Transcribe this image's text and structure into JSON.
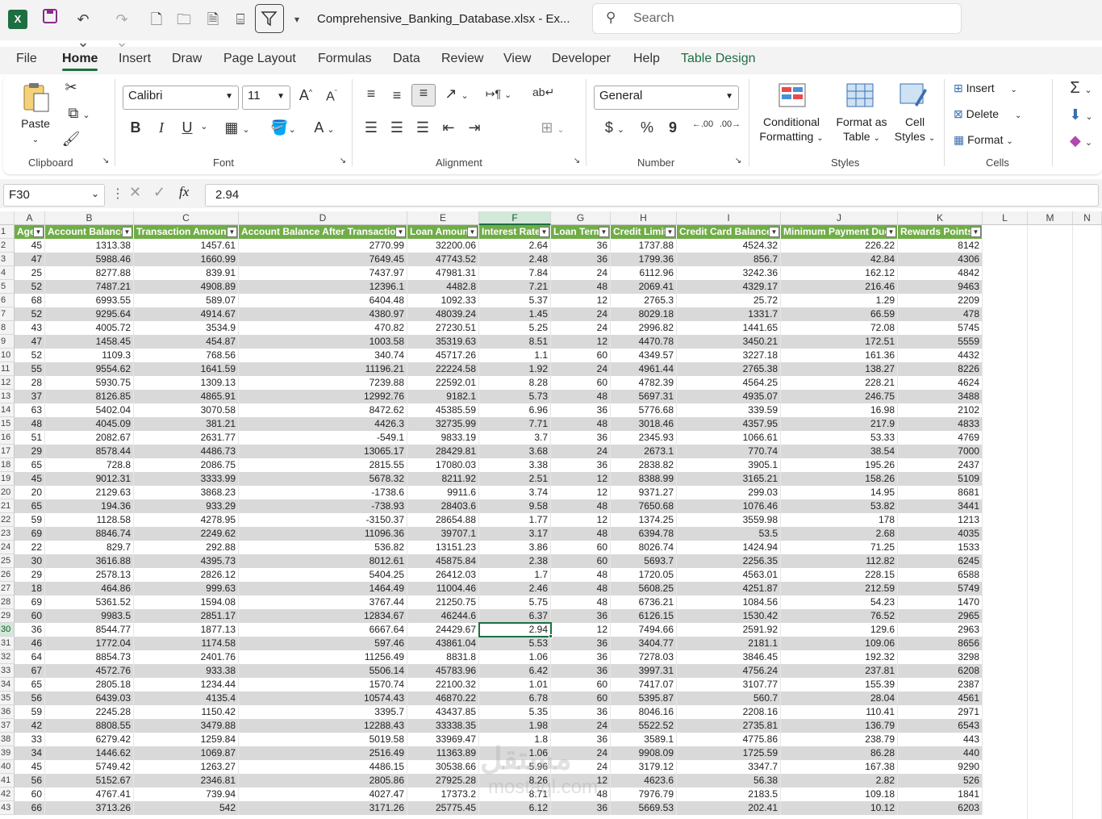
{
  "window": {
    "title": "Comprehensive_Banking_Database.xlsx  -  Ex...",
    "app_logo": "X",
    "search_placeholder": "Search"
  },
  "ribbon_tabs": [
    "File",
    "Home",
    "Insert",
    "Draw",
    "Page Layout",
    "Formulas",
    "Data",
    "Review",
    "View",
    "Developer",
    "Help",
    "Table Design"
  ],
  "active_tab": "Home",
  "ribbon": {
    "clipboard": {
      "paste_label": "Paste",
      "group_label": "Clipboard"
    },
    "font": {
      "font_name": "Calibri",
      "font_size": "11",
      "group_label": "Font",
      "bold": "B",
      "italic": "I",
      "underline": "U",
      "grow": "A",
      "shrink": "A",
      "color": "A"
    },
    "alignment": {
      "group_label": "Alignment"
    },
    "number": {
      "format": "General",
      "group_label": "Number",
      "currency": "$",
      "percent": "%",
      "comma": "9",
      "inc_decimal": ".00",
      "dec_decimal": ".00"
    },
    "styles": {
      "conditional_formatting_1": "Conditional",
      "conditional_formatting_2": "Formatting",
      "format_as_table_1": "Format as",
      "format_as_table_2": "Table",
      "cell_styles_1": "Cell",
      "cell_styles_2": "Styles",
      "group_label": "Styles"
    },
    "cells": {
      "insert_label": "Insert",
      "delete_label": "Delete",
      "format_label": "Format",
      "group_label": "Cells"
    }
  },
  "formula_bar": {
    "name_box": "F30",
    "fx": "fx",
    "formula": "2.94"
  },
  "columns": [
    "A",
    "B",
    "C",
    "D",
    "E",
    "F",
    "G",
    "H",
    "I",
    "J",
    "K",
    "L",
    "M",
    "N"
  ],
  "selected_cell": {
    "row": 30,
    "col": "F"
  },
  "table_headers": [
    "Age",
    "Account Balance",
    "Transaction Amount",
    "Account Balance After Transaction",
    "Loan Amount",
    "Interest Rate",
    "Loan Term",
    "Credit Limit",
    "Credit Card Balance",
    "Minimum Payment Due",
    "Rewards Points"
  ],
  "rows": [
    [
      "45",
      "1313.38",
      "1457.61",
      "2770.99",
      "32200.06",
      "2.64",
      "36",
      "1737.88",
      "4524.32",
      "226.22",
      "8142"
    ],
    [
      "47",
      "5988.46",
      "1660.99",
      "7649.45",
      "47743.52",
      "2.48",
      "36",
      "1799.36",
      "856.7",
      "42.84",
      "4306"
    ],
    [
      "25",
      "8277.88",
      "839.91",
      "7437.97",
      "47981.31",
      "7.84",
      "24",
      "6112.96",
      "3242.36",
      "162.12",
      "4842"
    ],
    [
      "52",
      "7487.21",
      "4908.89",
      "12396.1",
      "4482.8",
      "7.21",
      "48",
      "2069.41",
      "4329.17",
      "216.46",
      "9463"
    ],
    [
      "68",
      "6993.55",
      "589.07",
      "6404.48",
      "1092.33",
      "5.37",
      "12",
      "2765.3",
      "25.72",
      "1.29",
      "2209"
    ],
    [
      "52",
      "9295.64",
      "4914.67",
      "4380.97",
      "48039.24",
      "1.45",
      "24",
      "8029.18",
      "1331.7",
      "66.59",
      "478"
    ],
    [
      "43",
      "4005.72",
      "3534.9",
      "470.82",
      "27230.51",
      "5.25",
      "24",
      "2996.82",
      "1441.65",
      "72.08",
      "5745"
    ],
    [
      "47",
      "1458.45",
      "454.87",
      "1003.58",
      "35319.63",
      "8.51",
      "12",
      "4470.78",
      "3450.21",
      "172.51",
      "5559"
    ],
    [
      "52",
      "1109.3",
      "768.56",
      "340.74",
      "45717.26",
      "1.1",
      "60",
      "4349.57",
      "3227.18",
      "161.36",
      "4432"
    ],
    [
      "55",
      "9554.62",
      "1641.59",
      "11196.21",
      "22224.58",
      "1.92",
      "24",
      "4961.44",
      "2765.38",
      "138.27",
      "8226"
    ],
    [
      "28",
      "5930.75",
      "1309.13",
      "7239.88",
      "22592.01",
      "8.28",
      "60",
      "4782.39",
      "4564.25",
      "228.21",
      "4624"
    ],
    [
      "37",
      "8126.85",
      "4865.91",
      "12992.76",
      "9182.1",
      "5.73",
      "48",
      "5697.31",
      "4935.07",
      "246.75",
      "3488"
    ],
    [
      "63",
      "5402.04",
      "3070.58",
      "8472.62",
      "45385.59",
      "6.96",
      "36",
      "5776.68",
      "339.59",
      "16.98",
      "2102"
    ],
    [
      "48",
      "4045.09",
      "381.21",
      "4426.3",
      "32735.99",
      "7.71",
      "48",
      "3018.46",
      "4357.95",
      "217.9",
      "4833"
    ],
    [
      "51",
      "2082.67",
      "2631.77",
      "-549.1",
      "9833.19",
      "3.7",
      "36",
      "2345.93",
      "1066.61",
      "53.33",
      "4769"
    ],
    [
      "29",
      "8578.44",
      "4486.73",
      "13065.17",
      "28429.81",
      "3.68",
      "24",
      "2673.1",
      "770.74",
      "38.54",
      "7000"
    ],
    [
      "65",
      "728.8",
      "2086.75",
      "2815.55",
      "17080.03",
      "3.38",
      "36",
      "2838.82",
      "3905.1",
      "195.26",
      "2437"
    ],
    [
      "45",
      "9012.31",
      "3333.99",
      "5678.32",
      "8211.92",
      "2.51",
      "12",
      "8388.99",
      "3165.21",
      "158.26",
      "5109"
    ],
    [
      "20",
      "2129.63",
      "3868.23",
      "-1738.6",
      "9911.6",
      "3.74",
      "12",
      "9371.27",
      "299.03",
      "14.95",
      "8681"
    ],
    [
      "65",
      "194.36",
      "933.29",
      "-738.93",
      "28403.6",
      "9.58",
      "48",
      "7650.68",
      "1076.46",
      "53.82",
      "3441"
    ],
    [
      "59",
      "1128.58",
      "4278.95",
      "-3150.37",
      "28654.88",
      "1.77",
      "12",
      "1374.25",
      "3559.98",
      "178",
      "1213"
    ],
    [
      "69",
      "8846.74",
      "2249.62",
      "11096.36",
      "39707.1",
      "3.17",
      "48",
      "6394.78",
      "53.5",
      "2.68",
      "4035"
    ],
    [
      "22",
      "829.7",
      "292.88",
      "536.82",
      "13151.23",
      "3.86",
      "60",
      "8026.74",
      "1424.94",
      "71.25",
      "1533"
    ],
    [
      "30",
      "3616.88",
      "4395.73",
      "8012.61",
      "45875.84",
      "2.38",
      "60",
      "5693.7",
      "2256.35",
      "112.82",
      "6245"
    ],
    [
      "29",
      "2578.13",
      "2826.12",
      "5404.25",
      "26412.03",
      "1.7",
      "48",
      "1720.05",
      "4563.01",
      "228.15",
      "6588"
    ],
    [
      "18",
      "464.86",
      "999.63",
      "1464.49",
      "11004.46",
      "2.46",
      "48",
      "5608.25",
      "4251.87",
      "212.59",
      "5749"
    ],
    [
      "69",
      "5361.52",
      "1594.08",
      "3767.44",
      "21250.75",
      "5.75",
      "48",
      "6736.21",
      "1084.56",
      "54.23",
      "1470"
    ],
    [
      "60",
      "9983.5",
      "2851.17",
      "12834.67",
      "46244.6",
      "6.37",
      "36",
      "6126.15",
      "1530.42",
      "76.52",
      "2965"
    ],
    [
      "36",
      "8544.77",
      "1877.13",
      "6667.64",
      "24429.67",
      "2.94",
      "12",
      "7494.66",
      "2591.92",
      "129.6",
      "2963"
    ],
    [
      "46",
      "1772.04",
      "1174.58",
      "597.46",
      "43861.04",
      "5.53",
      "36",
      "3404.77",
      "2181.1",
      "109.06",
      "8656"
    ],
    [
      "64",
      "8854.73",
      "2401.76",
      "11256.49",
      "8831.8",
      "1.06",
      "36",
      "7278.03",
      "3846.45",
      "192.32",
      "3298"
    ],
    [
      "67",
      "4572.76",
      "933.38",
      "5506.14",
      "45783.96",
      "6.42",
      "36",
      "3997.31",
      "4756.24",
      "237.81",
      "6208"
    ],
    [
      "65",
      "2805.18",
      "1234.44",
      "1570.74",
      "22100.32",
      "1.01",
      "60",
      "7417.07",
      "3107.77",
      "155.39",
      "2387"
    ],
    [
      "56",
      "6439.03",
      "4135.4",
      "10574.43",
      "46870.22",
      "6.78",
      "60",
      "5395.87",
      "560.7",
      "28.04",
      "4561"
    ],
    [
      "59",
      "2245.28",
      "1150.42",
      "3395.7",
      "43437.85",
      "5.35",
      "36",
      "8046.16",
      "2208.16",
      "110.41",
      "2971"
    ],
    [
      "42",
      "8808.55",
      "3479.88",
      "12288.43",
      "33338.35",
      "1.98",
      "24",
      "5522.52",
      "2735.81",
      "136.79",
      "6543"
    ],
    [
      "33",
      "6279.42",
      "1259.84",
      "5019.58",
      "33969.47",
      "1.8",
      "36",
      "3589.1",
      "4775.86",
      "238.79",
      "443"
    ],
    [
      "34",
      "1446.62",
      "1069.87",
      "2516.49",
      "11363.89",
      "1.06",
      "24",
      "9908.09",
      "1725.59",
      "86.28",
      "440"
    ],
    [
      "45",
      "5749.42",
      "1263.27",
      "4486.15",
      "30538.66",
      "5.96",
      "24",
      "3179.12",
      "3347.7",
      "167.38",
      "9290"
    ],
    [
      "56",
      "5152.67",
      "2346.81",
      "2805.86",
      "27925.28",
      "8.26",
      "12",
      "4623.6",
      "56.38",
      "2.82",
      "526"
    ],
    [
      "60",
      "4767.41",
      "739.94",
      "4027.47",
      "17373.2",
      "8.71",
      "48",
      "7976.79",
      "2183.5",
      "109.18",
      "1841"
    ],
    [
      "66",
      "3713.26",
      "542",
      "3171.26",
      "25775.45",
      "6.12",
      "36",
      "5669.53",
      "202.41",
      "10.12",
      "6203"
    ]
  ],
  "watermark": {
    "line1": "مستقل",
    "line2": "mostaql.com"
  },
  "colors": {
    "accent": "#1d6f42",
    "table_header": "#70ad47",
    "band": "#d9d9d9"
  }
}
